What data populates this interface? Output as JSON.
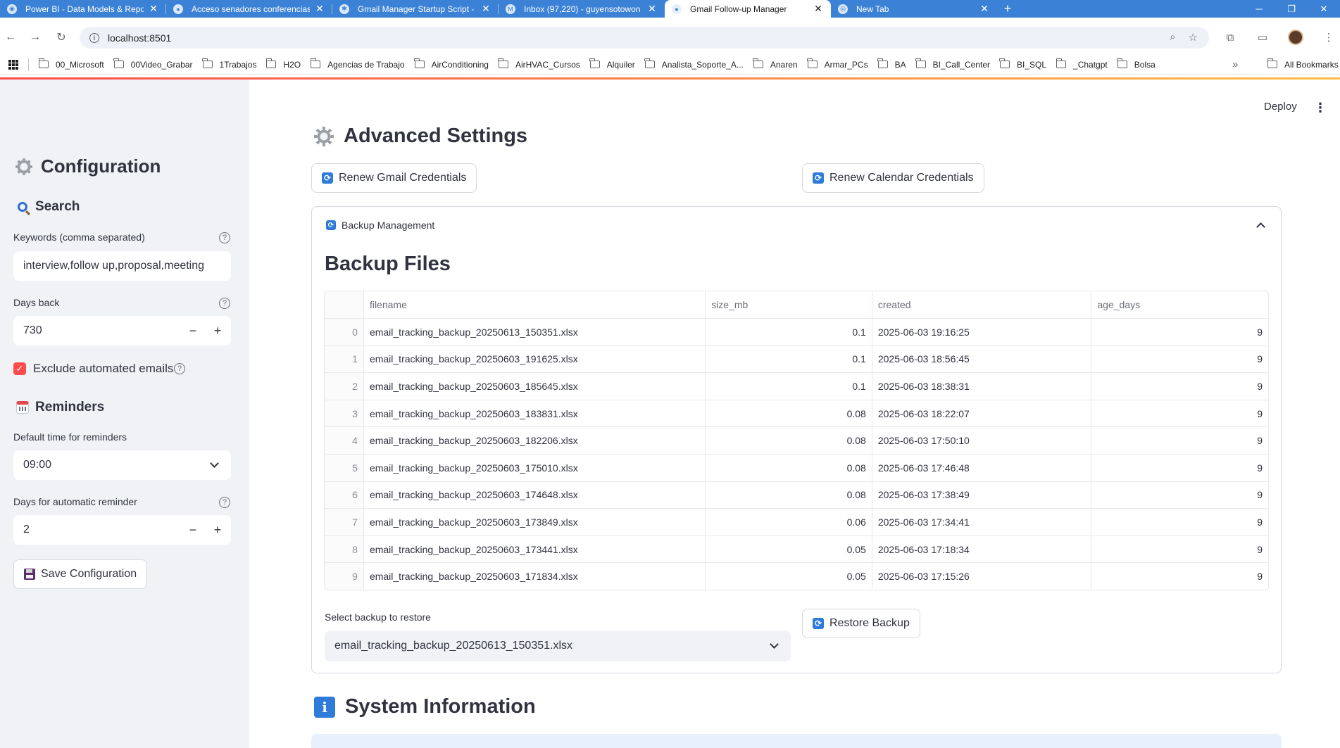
{
  "browser": {
    "tabs": [
      {
        "title": "Power BI - Data Models & Repo",
        "active": false
      },
      {
        "title": "Acceso senadores conferencias",
        "active": false
      },
      {
        "title": "Gmail Manager Startup Script -",
        "active": false
      },
      {
        "title": "Inbox (97,220) - guyensotowon",
        "active": false
      },
      {
        "title": "Gmail Follow-up Manager",
        "active": true
      },
      {
        "title": "New Tab",
        "active": false
      }
    ],
    "url": "localhost:8501",
    "bookmarks": [
      "00_Microsoft",
      "00Video_Grabar",
      "1Trabajos",
      "H2O",
      "Agencias de Trabajo",
      "AirConditioning",
      "AirHVAC_Cursos",
      "Alquiler",
      "Analista_Soporte_A...",
      "Anaren",
      "Armar_PCs",
      "BA",
      "BI_Call_Center",
      "BI_SQL",
      "_Chatgpt",
      "Bolsa"
    ],
    "all_bookmarks": "All Bookmarks",
    "more": "»",
    "accent": "#3b82d6"
  },
  "toolbar": {
    "deploy_label": "Deploy",
    "menu_label": "⋮"
  },
  "sidebar": {
    "title": "Configuration",
    "search_header": "Search",
    "keywords_label": "Keywords (comma separated)",
    "keywords_value": "interview,follow up,proposal,meeting",
    "days_back_label": "Days back",
    "days_back_value": "730",
    "exclude_label": "Exclude automated emails",
    "exclude_checked": true,
    "reminders_header": "Reminders",
    "default_time_label": "Default time for reminders",
    "default_time_value": "09:00",
    "auto_days_label": "Days for automatic reminder",
    "auto_days_value": "2",
    "save_label": "Save Configuration",
    "minus": "−",
    "plus": "+"
  },
  "main": {
    "advanced_title": "Advanced Settings",
    "renew_gmail_label": "Renew Gmail Credentials",
    "renew_calendar_label": "Renew Calendar Credentials",
    "backup_expander_label": "Backup Management",
    "backup_files_title": "Backup Files",
    "table": {
      "columns": [
        "",
        "filename",
        "size_mb",
        "created",
        "age_days"
      ],
      "rows": [
        [
          "0",
          "email_tracking_backup_20250613_150351.xlsx",
          "0.1",
          "2025-06-03 19:16:25",
          "9"
        ],
        [
          "1",
          "email_tracking_backup_20250603_191625.xlsx",
          "0.1",
          "2025-06-03 18:56:45",
          "9"
        ],
        [
          "2",
          "email_tracking_backup_20250603_185645.xlsx",
          "0.1",
          "2025-06-03 18:38:31",
          "9"
        ],
        [
          "3",
          "email_tracking_backup_20250603_183831.xlsx",
          "0.08",
          "2025-06-03 18:22:07",
          "9"
        ],
        [
          "4",
          "email_tracking_backup_20250603_182206.xlsx",
          "0.08",
          "2025-06-03 17:50:10",
          "9"
        ],
        [
          "5",
          "email_tracking_backup_20250603_175010.xlsx",
          "0.08",
          "2025-06-03 17:46:48",
          "9"
        ],
        [
          "6",
          "email_tracking_backup_20250603_174648.xlsx",
          "0.08",
          "2025-06-03 17:38:49",
          "9"
        ],
        [
          "7",
          "email_tracking_backup_20250603_173849.xlsx",
          "0.06",
          "2025-06-03 17:34:41",
          "9"
        ],
        [
          "8",
          "email_tracking_backup_20250603_173441.xlsx",
          "0.05",
          "2025-06-03 17:18:34",
          "9"
        ],
        [
          "9",
          "email_tracking_backup_20250603_171834.xlsx",
          "0.05",
          "2025-06-03 17:15:26",
          "9"
        ]
      ]
    },
    "select_backup_label": "Select backup to restore",
    "select_backup_value": "email_tracking_backup_20250613_150351.xlsx",
    "restore_label": "Restore Backup",
    "system_info_title": "System Information"
  },
  "colors": {
    "primary": "#ff4b4b",
    "sidebar_bg": "#f0f2f6",
    "text": "#31333f",
    "info_icon": "#2f7bd9"
  }
}
